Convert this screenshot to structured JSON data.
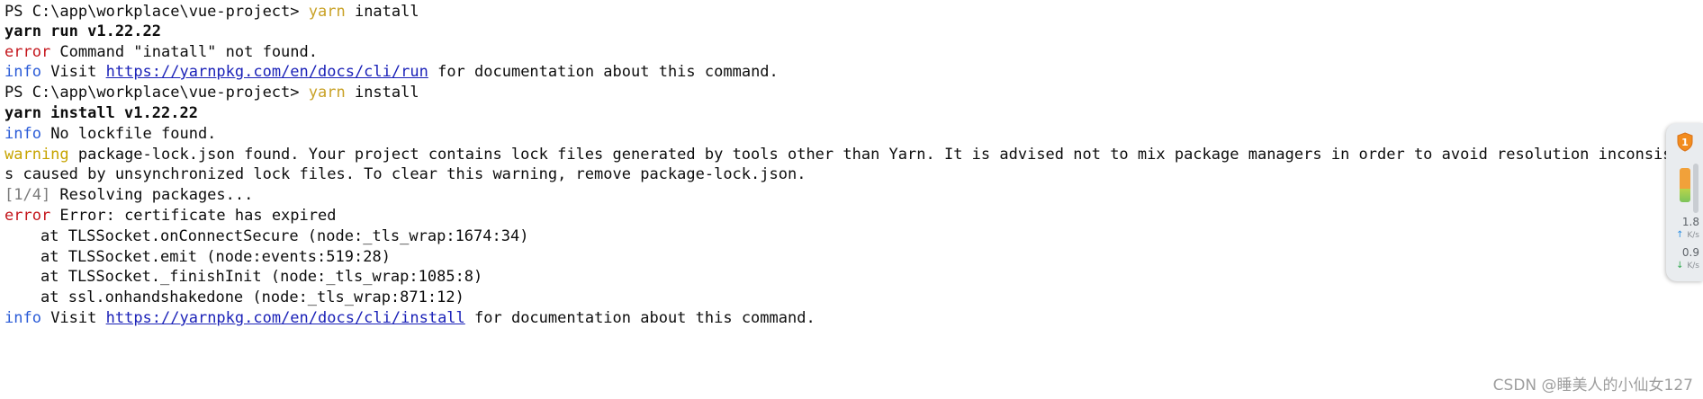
{
  "terminal": {
    "lines": [
      {
        "prompt": "PS C:\\app\\workplace\\vue-project>",
        "cmd": "yarn",
        "arg": " inatall"
      },
      {
        "text": "yarn run v1.22.22"
      },
      {
        "label": "error",
        "text": " Command \"inatall\" not found."
      },
      {
        "label": "info",
        "pre": " Visit ",
        "link": "https://yarnpkg.com/en/docs/cli/run",
        "post": " for documentation about this command."
      },
      {
        "prompt": "PS C:\\app\\workplace\\vue-project>",
        "cmd": "yarn",
        "arg": " install"
      },
      {
        "text": "yarn install v1.22.22"
      },
      {
        "label": "info",
        "text": " No lockfile found."
      },
      {
        "label": "warning",
        "text": " package-lock.json found. Your project contains lock files generated by tools other than Yarn. It is advised not to mix package managers in order to avoid resolution inconsistenci"
      },
      {
        "text": "s caused by unsynchronized lock files. To clear this warning, remove package-lock.json."
      },
      {
        "label": "[1/4]",
        "text": " Resolving packages..."
      },
      {
        "label": "error",
        "text": " Error: certificate has expired"
      },
      {
        "text": "at TLSSocket.onConnectSecure (node:_tls_wrap:1674:34)"
      },
      {
        "text": "at TLSSocket.emit (node:events:519:28)"
      },
      {
        "text": "at TLSSocket._finishInit (node:_tls_wrap:1085:8)"
      },
      {
        "text": "at ssl.onhandshakedone (node:_tls_wrap:871:12)"
      },
      {
        "label": "info",
        "pre": " Visit ",
        "link": "https://yarnpkg.com/en/docs/cli/install",
        "post": " for documentation about this command."
      }
    ]
  },
  "side_widget": {
    "badge": "1",
    "upload_speed": "1.8",
    "upload_unit": "K/s",
    "download_speed": "0.9",
    "download_unit": "K/s",
    "icon": "shield-icon"
  },
  "watermark": "CSDN @睡美人的小仙女127",
  "colors": {
    "yarn_keyword": "#c9a227",
    "error": "#c4161c",
    "info": "#2a5bd7",
    "warning": "#c7a400",
    "link": "#1b22b8"
  }
}
